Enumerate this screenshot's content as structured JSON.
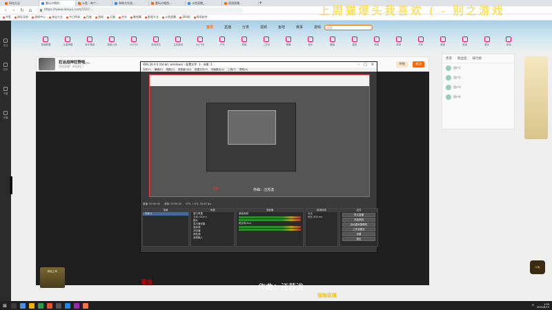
{
  "browser": {
    "tabs": [
      {
        "label": "网站大全",
        "active": false
      },
      {
        "label": "重玩对唱首...",
        "active": true
      },
      {
        "label": "斗鱼 - 每个...",
        "active": false
      },
      {
        "label": "单刷大作战...",
        "active": false
      },
      {
        "label": "重玩对唱首...",
        "active": false
      },
      {
        "label": "斗鱼直播_...",
        "active": false
      },
      {
        "label": "网游直播...",
        "active": false
      }
    ],
    "url": "https://www.douyu.com/1517..."
  },
  "bookmarks": [
    "书签",
    "网址导航",
    "游戏中心",
    "淘宝大全",
    "今日特卖",
    "百度",
    "游戏",
    "天猫",
    "京东",
    "聚划算",
    "影视大全",
    "斗鱼直播",
    "360网",
    "常用软件"
  ],
  "site": {
    "nav_items": [
      "首页",
      "直播",
      "分类",
      "视频",
      "鱼吧",
      "赛事",
      "游戏",
      "斗鱼伴侣"
    ],
    "search_placeholder": "搜索",
    "categories": [
      "英雄联盟",
      "王者荣耀",
      "和平精英",
      "穿越火线",
      "DOTA2",
      "绝地求生",
      "主机游戏",
      "QQ飞车",
      "户外",
      "颜值",
      "二次元",
      "棋牌",
      "音乐",
      "舞蹈",
      "星秀",
      "科技",
      "体育",
      "汽车",
      "美食",
      "旅游",
      "娱乐",
      "综合"
    ],
    "left_rail": [
      "关注",
      "历史",
      "下载",
      "开播"
    ],
    "room": {
      "title": "狂派战神狂野啦...",
      "meta": "游戏直播 · 单机热门",
      "report_label": "举报",
      "follow_label": "关注"
    },
    "rank": {
      "tabs": [
        "贵宾",
        "粉丝团",
        "排行榜"
      ],
      "rows": [
        "用户1",
        "用户2",
        "用户3",
        "用户4"
      ]
    }
  },
  "obs": {
    "title": "OBS 26.0.0 (64-bit, windows) - 配置文件: 1 - 场景: 2",
    "menu": [
      "文件(F)",
      "编辑(E)",
      "视图(V)",
      "停靠窗口(D)",
      "配置文件(P)",
      "场景集合(S)",
      "工具(T)",
      "帮助(H)"
    ],
    "preview_caption": "作曲：汪苏泷",
    "status_bits": [
      "直播: 00:00:00",
      "录制: 00:00:00",
      "CPU: 1.5%, 30.00 fps"
    ],
    "panels": {
      "scenes": {
        "head": "场景",
        "rows": [
          "场景 2"
        ]
      },
      "sources": {
        "head": "来源",
        "rows": [
          "窗口采集",
          "文本 (GDI+)",
          "图片",
          "显示器采集",
          "媒体源",
          "浏览器",
          "颜色源",
          "音频输入"
        ]
      },
      "mixer": {
        "head": "混音器",
        "rows": [
          "桌面音频",
          "麦克风/Aux"
        ]
      },
      "transitions": {
        "head": "转场特效",
        "rows": [
          "淡出",
          "时长 300 ms"
        ]
      },
      "controls": {
        "head": "控件",
        "buttons": [
          "停止直播",
          "开始录制",
          "启动虚拟摄像机",
          "工作室模式",
          "设置",
          "退出"
        ]
      }
    }
  },
  "overlays": {
    "title": "上周猫爆头我喜欢 ( - 别之游戏",
    "song_credit": "作曲：汪苏泷",
    "red_left": "歌曲",
    "yellow_tag": "猫咖直播",
    "bottom_badge": "粉丝上车",
    "corner_logo": "斗鱼"
  },
  "taskbar": {
    "tray_text": "中",
    "time": "1:59",
    "date": "2021/8/13"
  }
}
